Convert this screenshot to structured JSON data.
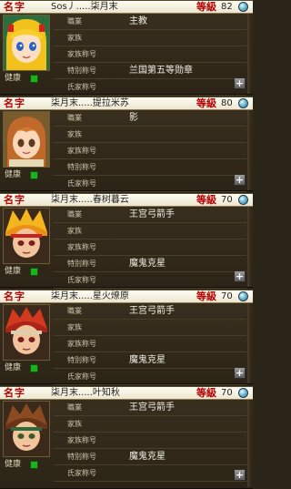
{
  "labels": {
    "name": "名字",
    "level": "等級",
    "health": "健康",
    "job": "職業",
    "family": "家族",
    "family_title": "家族称号",
    "special_title": "特別称号",
    "guild_family": "氏家称号"
  },
  "characters": [
    {
      "name": "Sos丿.....柒月末",
      "level": "82",
      "job": "主教",
      "family": "",
      "family_title": "",
      "special_title": "兰国第五等勋章",
      "guild_family": ""
    },
    {
      "name": "柒月末.....提拉米苏",
      "level": "80",
      "job": "影",
      "family": "",
      "family_title": "",
      "special_title": "",
      "guild_family": ""
    },
    {
      "name": "柒月末.....春树暮云",
      "level": "70",
      "job": "王宫弓箭手",
      "family": "",
      "family_title": "",
      "special_title": "魔鬼克星",
      "guild_family": ""
    },
    {
      "name": "柒月末.....星火燎原",
      "level": "70",
      "job": "王宫弓箭手",
      "family": "",
      "family_title": "",
      "special_title": "魔鬼克星",
      "guild_family": ""
    },
    {
      "name": "柒月末.....叶知秋",
      "level": "70",
      "job": "王宫弓箭手",
      "family": "",
      "family_title": "",
      "special_title": "魔鬼克星",
      "guild_family": ""
    }
  ],
  "colors": {
    "label_red": "#b30000",
    "panel_dark": "#2c2416",
    "health_green": "#1db21d"
  }
}
